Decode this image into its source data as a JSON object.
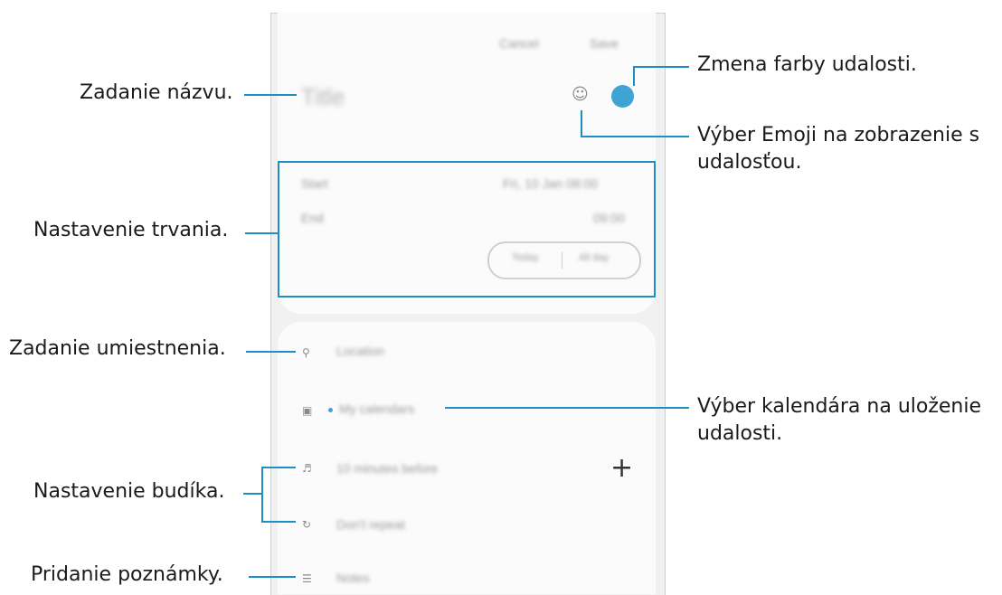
{
  "screen": {
    "top_actions": [
      "Cancel",
      "Save"
    ],
    "title_placeholder": "Title",
    "start_label": "Start",
    "start_value": "Fri, 10 Jan   08:00",
    "end_label": "End",
    "end_value": "09:00",
    "toggle_left": "Today",
    "toggle_right": "All day",
    "location": "Location",
    "calendar": "My calendars",
    "alarm": "10 minutes before",
    "repeat": "Don't repeat",
    "notes": "Notes",
    "colors": {
      "accent": "#3fa3d3",
      "callout": "#1c8fc4"
    }
  },
  "callouts": {
    "title": "Zadanie názvu.",
    "duration": "Nastavenie trvania.",
    "location": "Zadanie umiestnenia.",
    "alarm": "Nastavenie budíka.",
    "note": "Pridanie poznámky.",
    "color": "Zmena farby udalosti.",
    "emoji_line1": "Výber Emoji na zobrazenie s",
    "emoji_line2": "udalosťou.",
    "calendar_line1": "Výber kalendára na uloženie",
    "calendar_line2": "udalosti."
  }
}
